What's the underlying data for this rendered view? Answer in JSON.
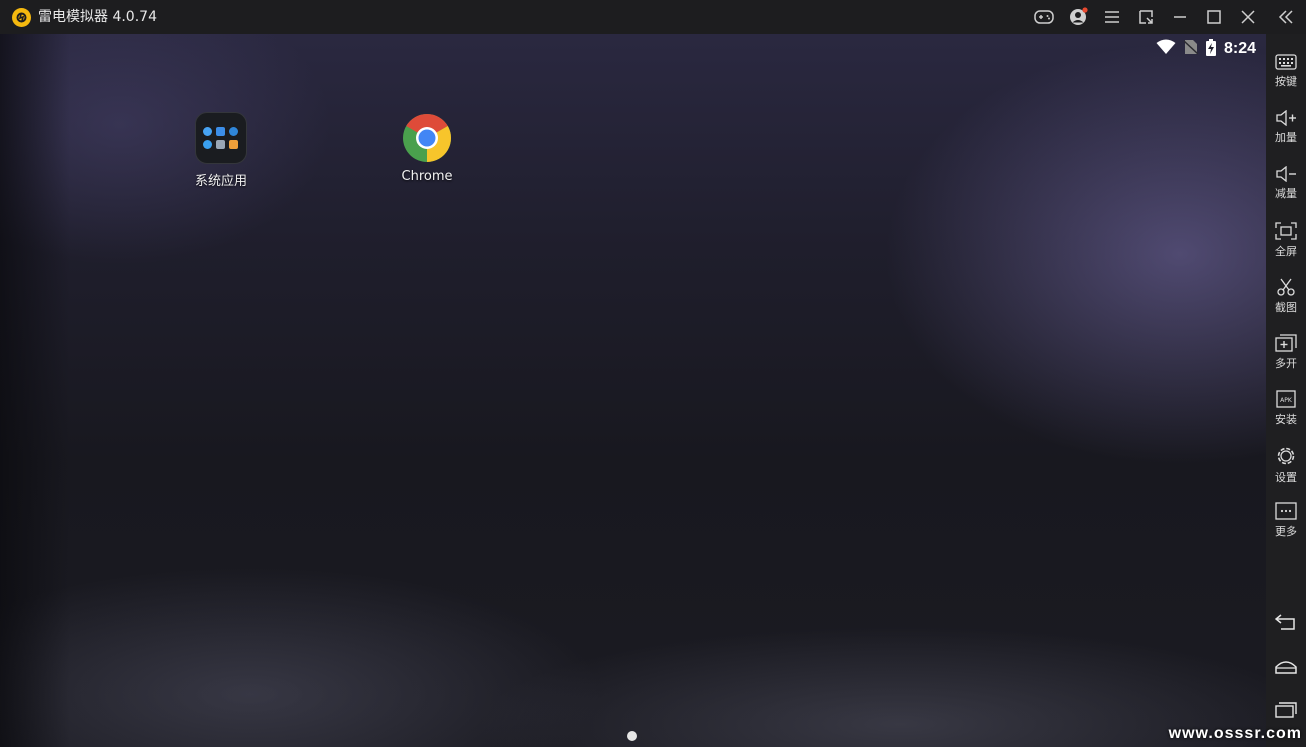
{
  "window": {
    "title": "雷电模拟器 4.0.74",
    "accent": "#f5b90f",
    "notification_dot": "#e8492f"
  },
  "titlebar_icons": [
    "gamepad-icon",
    "account-icon",
    "menu-icon",
    "shrink-icon",
    "minimize-icon",
    "maximize-icon",
    "close-icon",
    "collapse-sidebar-icon"
  ],
  "status_bar": {
    "time": "8:24",
    "icons": [
      "wifi-icon",
      "no-sim-icon",
      "battery-charging-icon"
    ]
  },
  "home": {
    "apps": [
      {
        "label": "系统应用",
        "icon": "folder-icon"
      },
      {
        "label": "Chrome",
        "icon": "chrome-icon"
      }
    ],
    "page_count": 1,
    "current_page": 1
  },
  "sidebar": {
    "items": [
      {
        "label": "按键",
        "icon": "keyboard-icon"
      },
      {
        "label": "加量",
        "icon": "volume-up-icon"
      },
      {
        "label": "减量",
        "icon": "volume-down-icon"
      },
      {
        "label": "全屏",
        "icon": "fullscreen-icon"
      },
      {
        "label": "截图",
        "icon": "scissors-icon"
      },
      {
        "label": "多开",
        "icon": "multi-instance-icon"
      },
      {
        "label": "安装",
        "icon": "apk-icon"
      },
      {
        "label": "设置",
        "icon": "gear-icon"
      },
      {
        "label": "更多",
        "icon": "more-icon"
      }
    ],
    "nav": [
      "back-icon",
      "home-icon",
      "recents-icon"
    ]
  },
  "watermark": "www.osssr.com"
}
